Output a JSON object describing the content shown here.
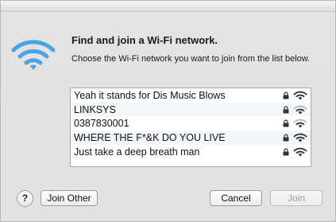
{
  "dialog": {
    "heading": "Find and join a Wi-Fi network.",
    "subheading": "Choose the Wi-Fi network you want to join from the list below.",
    "hero_icon": "wifi-icon"
  },
  "networks": [
    {
      "name": "Yeah it stands for Dis Music Blows",
      "secured": true,
      "signal": 3
    },
    {
      "name": "LINKSYS",
      "secured": true,
      "signal": 2
    },
    {
      "name": "0387830001",
      "secured": true,
      "signal": 2
    },
    {
      "name": "WHERE THE F*&K DO YOU LIVE",
      "secured": true,
      "signal": 3
    },
    {
      "name": "Just take a deep breath man",
      "secured": true,
      "signal": 3
    }
  ],
  "buttons": {
    "help": "?",
    "join_other": "Join Other",
    "cancel": "Cancel",
    "join": "Join"
  },
  "colors": {
    "wifi_blue": "#4aa3e6",
    "signal_dark": "#333333",
    "signal_light": "#b8b8b8"
  }
}
